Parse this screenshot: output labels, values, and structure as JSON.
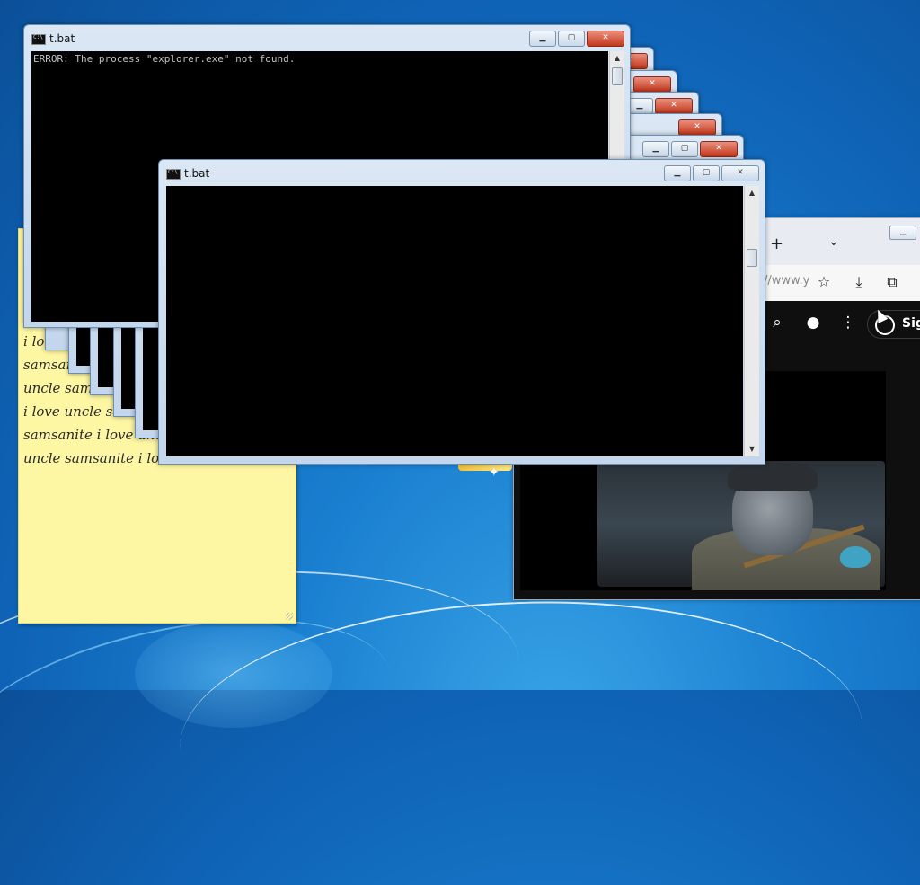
{
  "windows": {
    "back_title": "t.bat",
    "front_title": "t.bat",
    "error_line": "ERROR: The process \"explorer.exe\" not found.",
    "minimize_glyph": "▁",
    "maximize_glyph": "▢",
    "close_glyph": "✕"
  },
  "sticky_note": {
    "text": "i love uncle samsanite i love uncle samsanite i love uncle samsanite i love uncle samsanite i love uncle samsanite i love uncle samsanite i love uncle samsanite i love uncle samsanite i love uncle samsanite i love uncle samsanite"
  },
  "browser": {
    "new_tab_glyph": "+",
    "tab_list_glyph": "⌄",
    "url_fragment": "//www.y",
    "sign_in_label": "Sig",
    "icons": [
      "star-icon",
      "download-icon",
      "extensions-icon",
      "search-icon",
      "mic-icon",
      "more-icon",
      "user-icon"
    ]
  },
  "colors": {
    "desktop": "#0f63b6",
    "sticky": "#fdf6a3",
    "console": "#000000",
    "close_active": "#c4361c"
  }
}
